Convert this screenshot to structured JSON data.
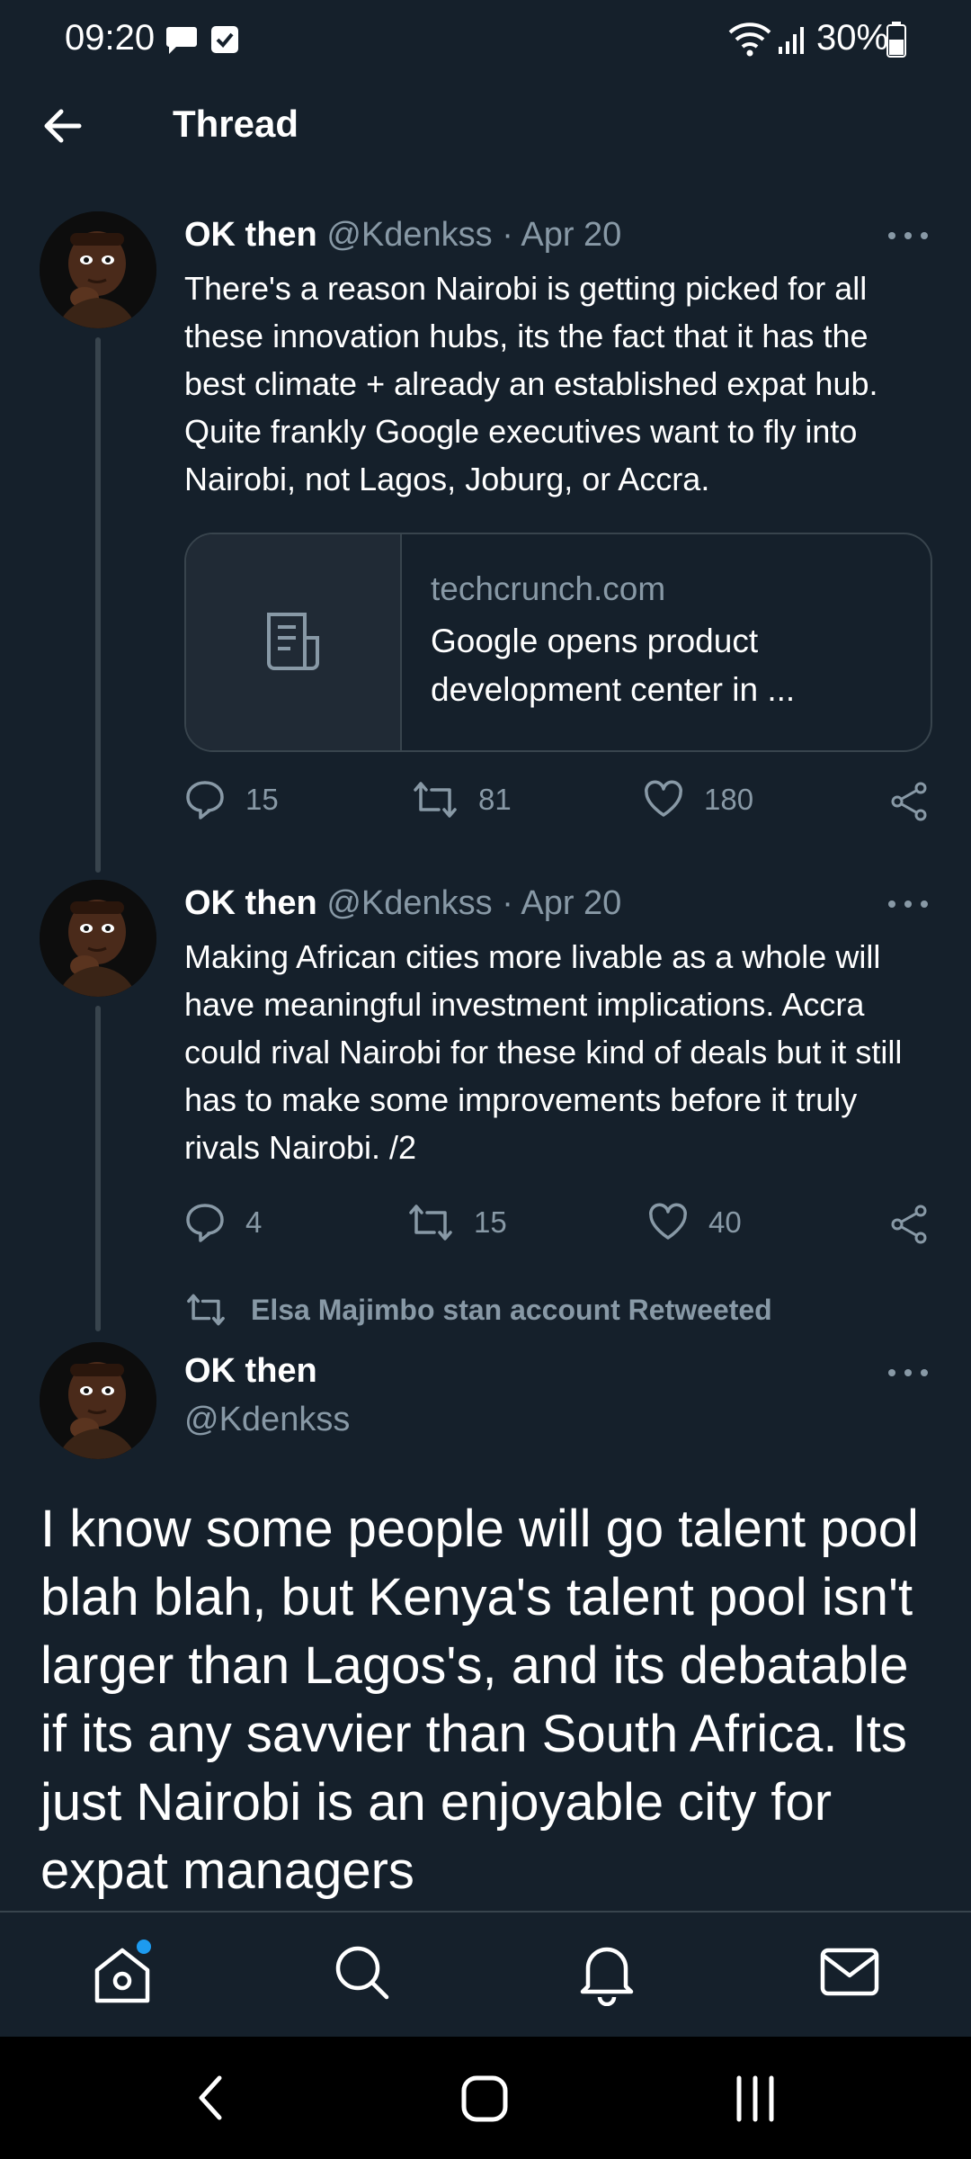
{
  "status_bar": {
    "time": "09:20",
    "battery": "30%",
    "icons": [
      "message-icon",
      "check-box-icon",
      "wifi-icon",
      "signal-icon",
      "battery-icon"
    ]
  },
  "header": {
    "title": "Thread",
    "back_icon": "arrow-left-icon"
  },
  "tweets": [
    {
      "name": "OK then",
      "handle": "@Kdenkss",
      "separator": "·",
      "date": "Apr 20",
      "text": "There's a reason Nairobi is getting picked for all these innovation hubs, its the fact that it has the best climate + already an established expat hub. Quite frankly Google executives want to fly into Nairobi, not Lagos, Joburg, or Accra.",
      "link_card": {
        "domain": "techcrunch.com",
        "title": "Google opens product development center in ...",
        "thumb_icon": "article-icon"
      },
      "replies": "15",
      "retweets": "81",
      "likes": "180"
    },
    {
      "name": "OK then",
      "handle": "@Kdenkss",
      "separator": "·",
      "date": "Apr 20",
      "text": "Making African cities more livable as a whole will have meaningful investment implications. Accra could rival Nairobi for these kind of deals but it still has to make some improvements before it truly rivals Nairobi. /2",
      "replies": "4",
      "retweets": "15",
      "likes": "40"
    }
  ],
  "focused_tweet": {
    "retweeted_by": "Elsa Majimbo stan account Retweeted",
    "name": "OK then",
    "handle": "@Kdenkss",
    "text": "I know some people will go talent pool blah blah, but Kenya's talent pool isn't larger than Lagos's, and its debatable if its any savvier than South Africa. Its just Nairobi is an enjoyable city for expat managers"
  },
  "bottom_nav": [
    "home-icon",
    "search-icon",
    "notifications-icon",
    "messages-icon"
  ],
  "system_nav": [
    "back-icon",
    "home-icon",
    "recents-icon"
  ],
  "colors": {
    "background": "#15202b",
    "muted": "#8899a6",
    "divider": "#38444d",
    "accent": "#1d9bf0"
  }
}
